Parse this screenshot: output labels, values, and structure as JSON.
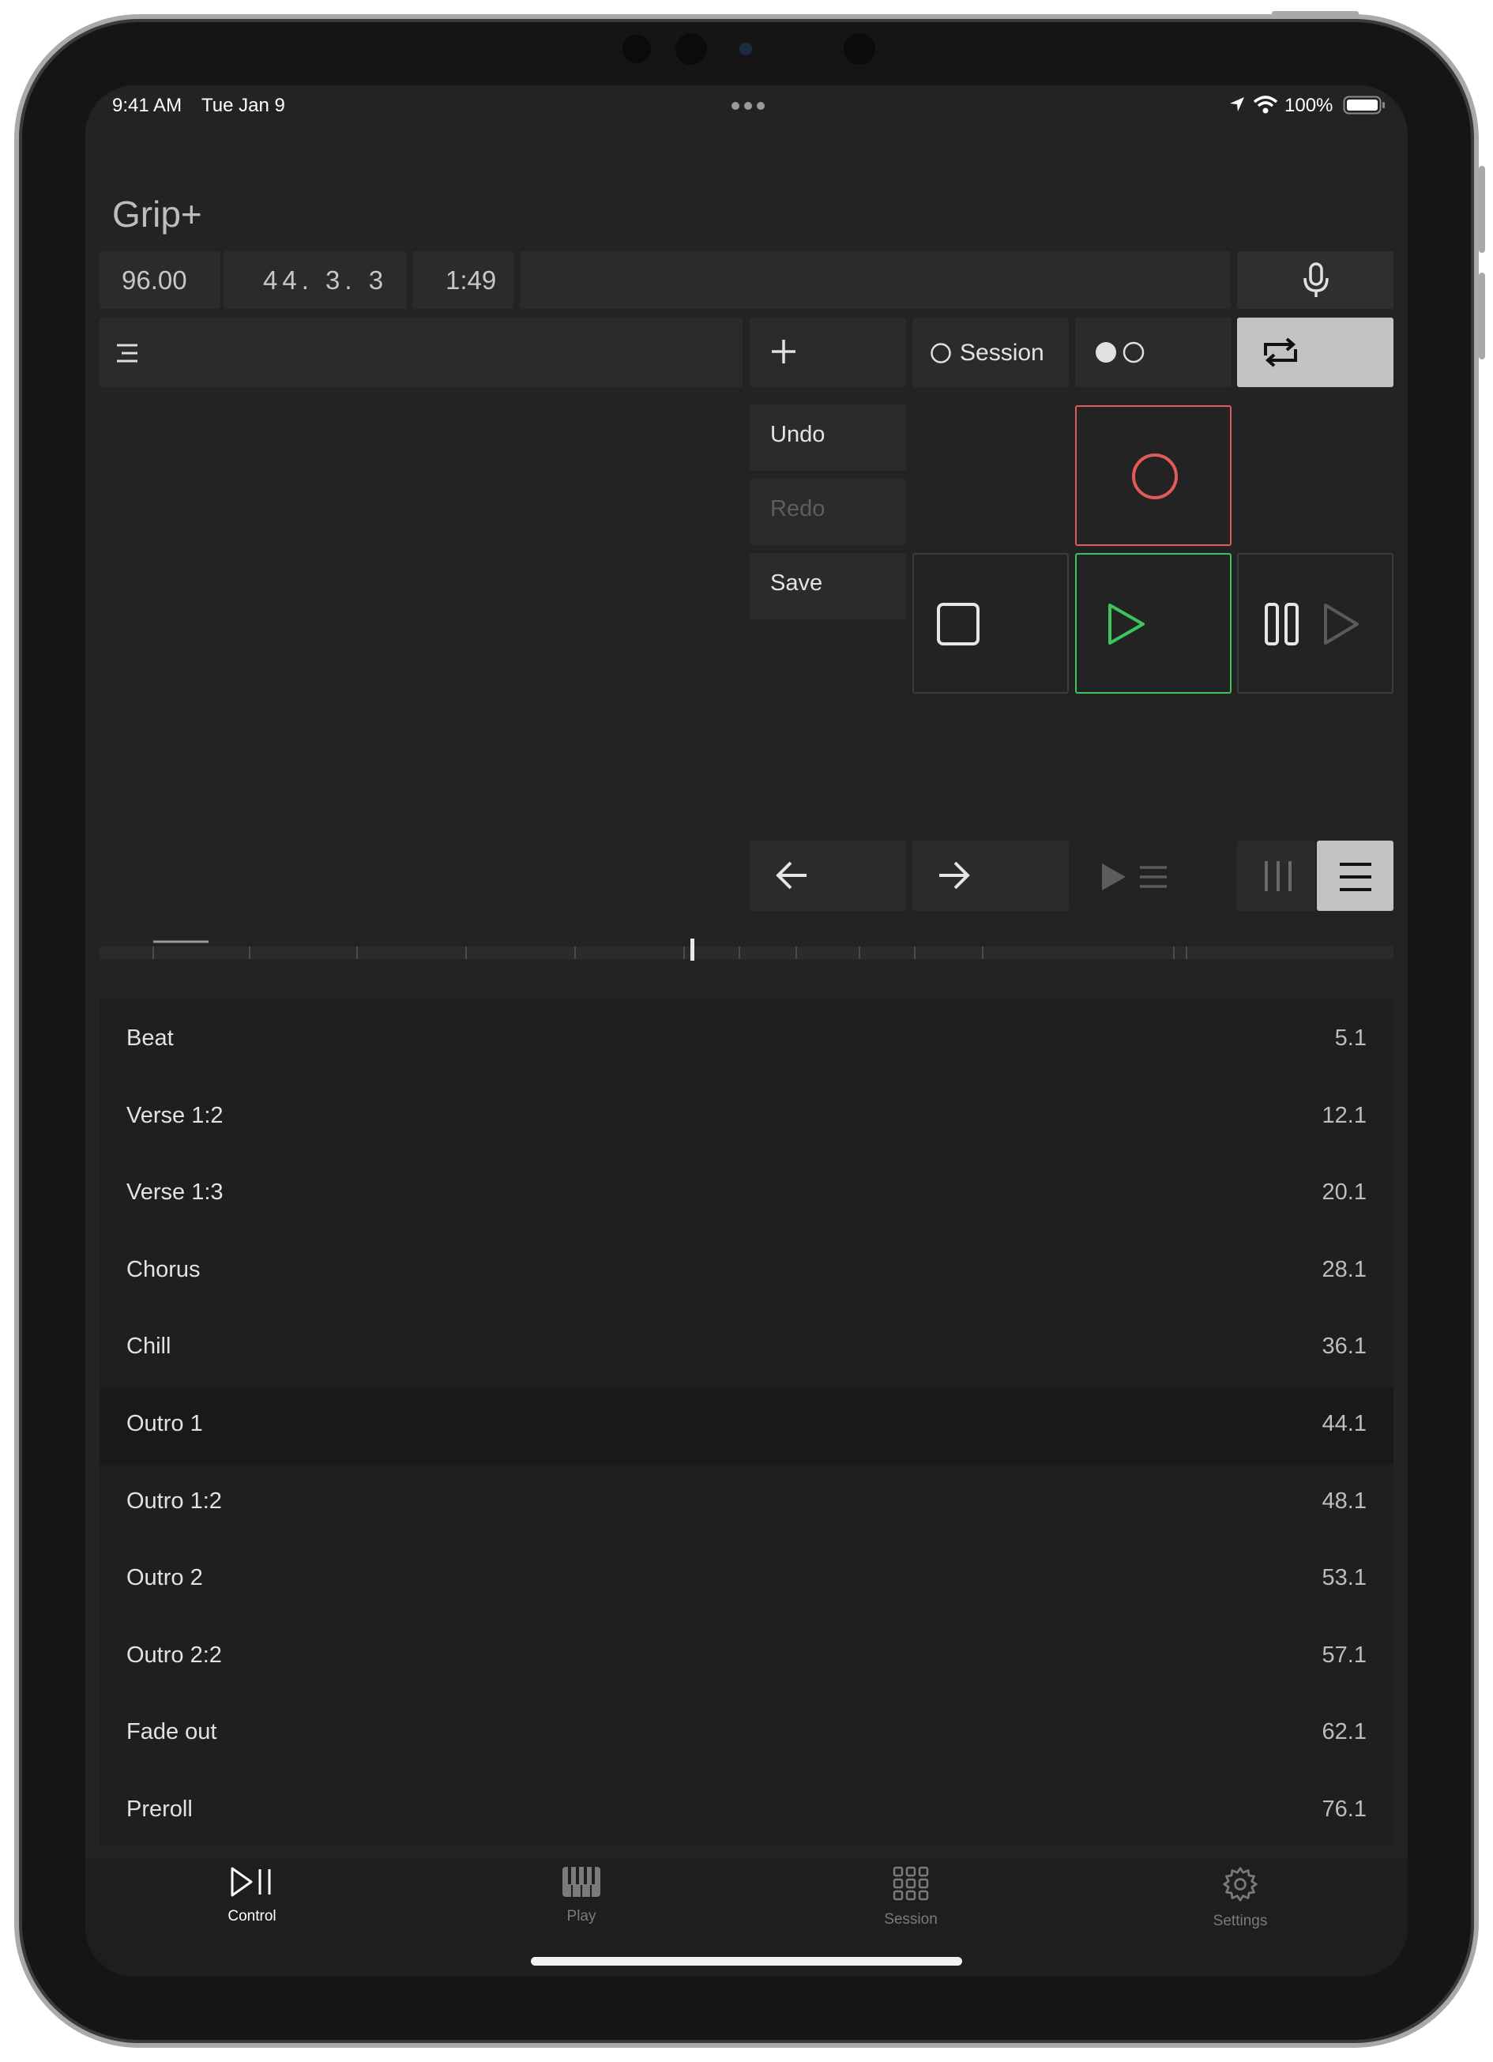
{
  "status_bar": {
    "time": "9:41 AM",
    "date": "Tue Jan 9",
    "battery": "100%"
  },
  "app": {
    "title": "Grip+"
  },
  "transport_readout": {
    "tempo": "96.00",
    "position": "44. 3. 3",
    "time": "1:49"
  },
  "toolbar": {
    "session_label": "Session"
  },
  "edit_menu": {
    "undo": "Undo",
    "redo": "Redo",
    "save": "Save"
  },
  "markers": [
    {
      "name": "Beat",
      "pos": "5.1"
    },
    {
      "name": "Verse 1:2",
      "pos": "12.1"
    },
    {
      "name": "Verse 1:3",
      "pos": "20.1"
    },
    {
      "name": "Chorus",
      "pos": "28.1"
    },
    {
      "name": "Chill",
      "pos": "36.1"
    },
    {
      "name": "Outro 1",
      "pos": "44.1",
      "selected": true
    },
    {
      "name": "Outro 1:2",
      "pos": "48.1"
    },
    {
      "name": "Outro 2",
      "pos": "53.1"
    },
    {
      "name": "Outro 2:2",
      "pos": "57.1"
    },
    {
      "name": "Fade out",
      "pos": "62.1"
    },
    {
      "name": "Preroll",
      "pos": "76.1"
    }
  ],
  "tabs": [
    {
      "label": "Control",
      "active": true
    },
    {
      "label": "Play"
    },
    {
      "label": "Session"
    },
    {
      "label": "Settings"
    }
  ],
  "colors": {
    "record": "#e35a5a",
    "play": "#3cc55c",
    "active_toggle": "#c3c3c3"
  }
}
